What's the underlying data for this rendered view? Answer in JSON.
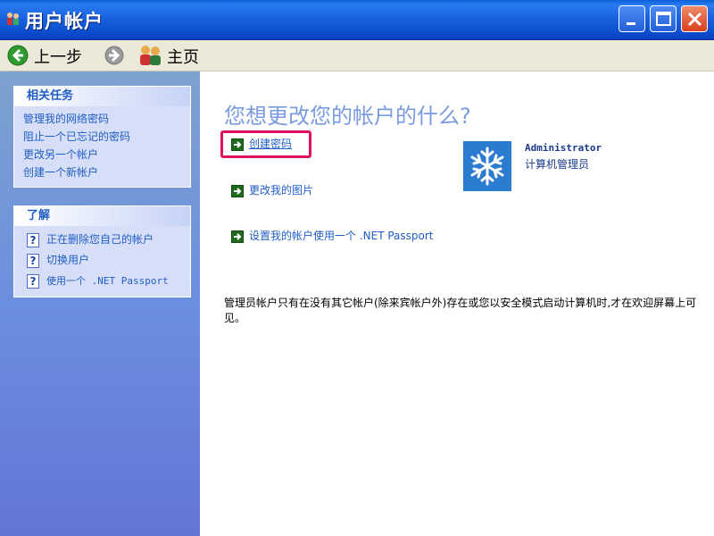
{
  "window": {
    "title": "用户帐户"
  },
  "toolbar": {
    "back_label": "上一步",
    "home_label": "主页"
  },
  "sidebar": {
    "related_tasks": {
      "header": "相关任务",
      "items": [
        {
          "label": "管理我的网络密码"
        },
        {
          "label": "阻止一个已忘记的密码"
        },
        {
          "label": "更改另一个帐户"
        },
        {
          "label": "创建一个新帐户"
        }
      ]
    },
    "learn": {
      "header": "了解",
      "items": [
        {
          "label": "正在删除您自己的帐户"
        },
        {
          "label": "切换用户"
        },
        {
          "label": "使用一个 .NET Passport"
        }
      ]
    }
  },
  "main": {
    "heading": "您想更改您的帐户的什么?",
    "options": [
      {
        "label": "创建密码"
      },
      {
        "label": "更改我的图片"
      },
      {
        "label": "设置我的帐户使用一个 .NET Passport"
      }
    ],
    "user": {
      "name": "Administrator",
      "role": "计算机管理员"
    },
    "note": "管理员帐户只有在没有其它帐户(除来宾帐户外)存在或您以安全模式启动计算机时,才在欢迎屏幕上可见。"
  },
  "colors": {
    "titlebar": "#0b4fcf",
    "link": "#215dc6",
    "highlight": "#e0115e",
    "sidebar": "#6b8fdf"
  }
}
